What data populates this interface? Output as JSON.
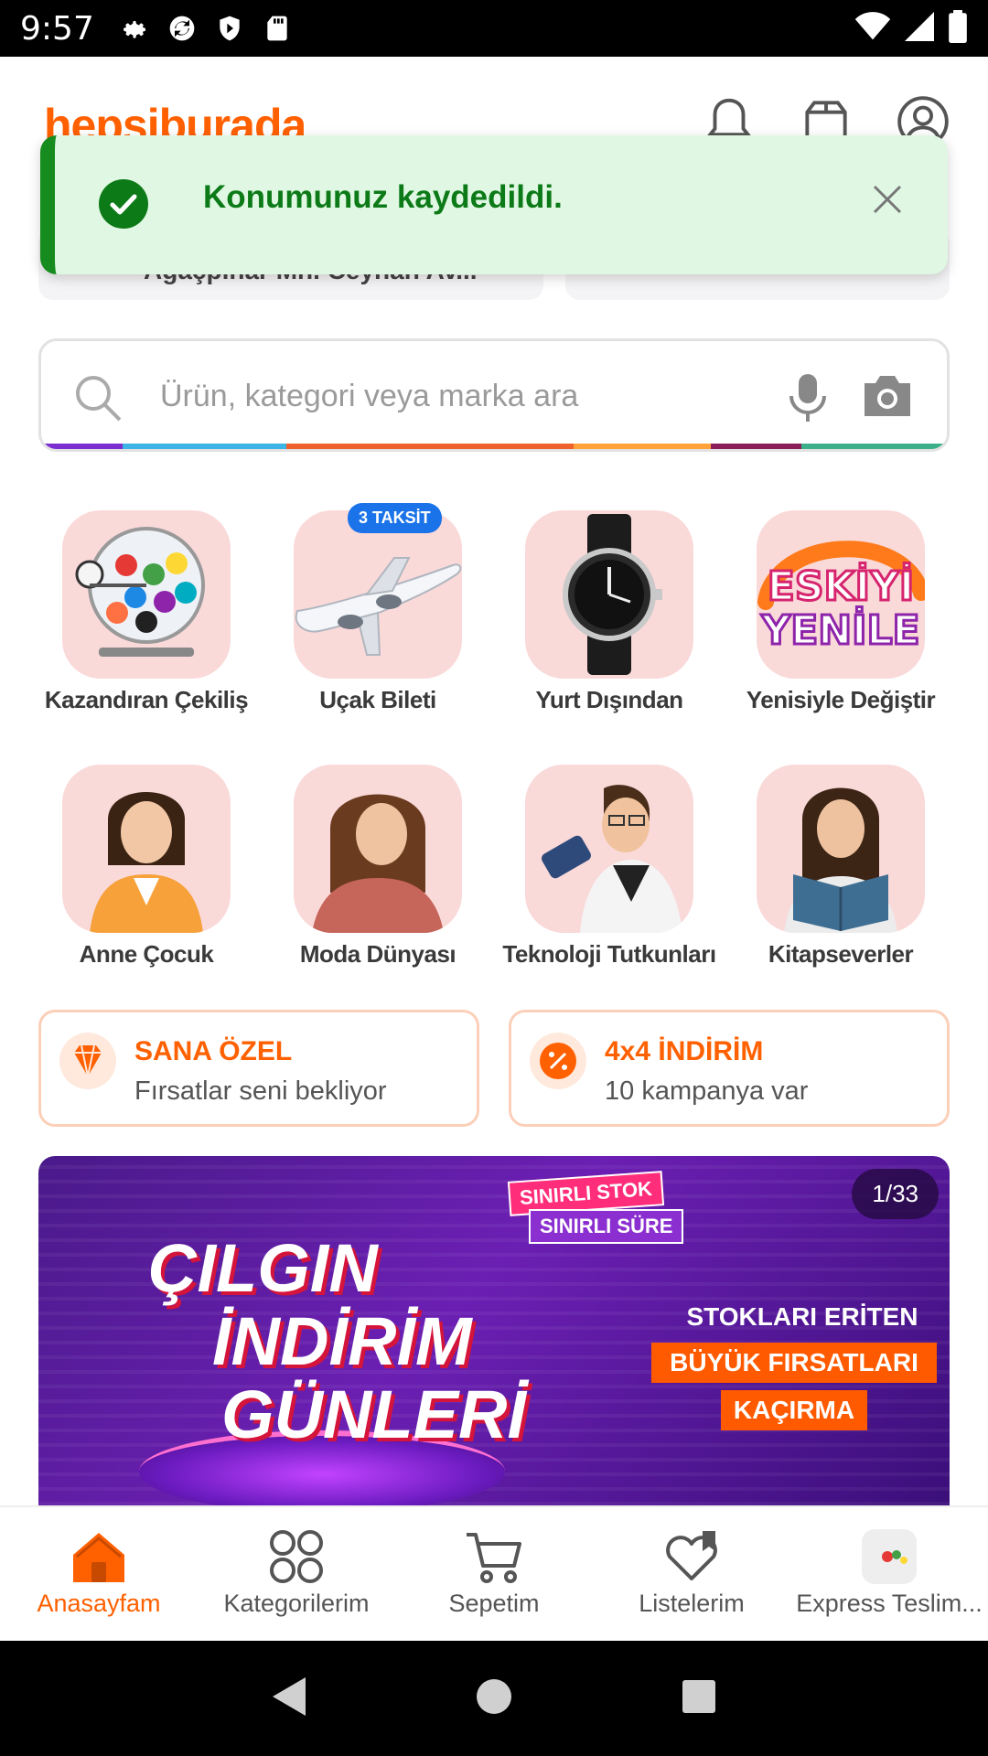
{
  "status_bar": {
    "time": "9:57"
  },
  "header": {
    "logo_text": "hepsiburada"
  },
  "location": {
    "text": "Ağaçpınar Mh. Ceyhan Av..."
  },
  "toast": {
    "message": "Konumunuz kaydedildi."
  },
  "search": {
    "placeholder": "Ürün, kategori veya marka ara"
  },
  "categories": [
    {
      "label": "Kazandıran Çekiliş"
    },
    {
      "label": "Uçak Bileti",
      "badge": "3 TAKSİT"
    },
    {
      "label": "Yurt Dışından"
    },
    {
      "label": "Yenisiyle Değiştir"
    },
    {
      "label": "Anne Çocuk"
    },
    {
      "label": "Moda Dünyası"
    },
    {
      "label": "Teknoloji Tutkunları"
    },
    {
      "label": "Kitapseverler"
    }
  ],
  "promos": [
    {
      "title": "SANA ÖZEL",
      "subtitle": "Fırsatlar seni bekliyor"
    },
    {
      "title": "4x4 İNDİRİM",
      "subtitle": "10 kampanya var"
    }
  ],
  "banner": {
    "counter": "1/33",
    "line1": "ÇILGIN",
    "line2": "İNDİRİM",
    "line3": "GÜNLERİ",
    "tag1": "SINIRLI STOK",
    "tag2": "SINIRLI SÜRE",
    "right1": "STOKLARI ERİTEN",
    "right2": "BÜYÜK FIRSATLARI",
    "right3": "KAÇIRMA"
  },
  "bottom_nav": [
    {
      "label": "Anasayfam",
      "icon": "home-icon"
    },
    {
      "label": "Kategorilerim",
      "icon": "categories-icon"
    },
    {
      "label": "Sepetim",
      "icon": "cart-icon"
    },
    {
      "label": "Listelerim",
      "icon": "heart-list-icon"
    },
    {
      "label": "Express Teslim...",
      "icon": "express-icon"
    }
  ],
  "colors": {
    "brand": "#ff6000",
    "toast_bg": "#e0f8e3",
    "toast_accent": "#168b1e",
    "category_bg": "#fad9d9"
  }
}
